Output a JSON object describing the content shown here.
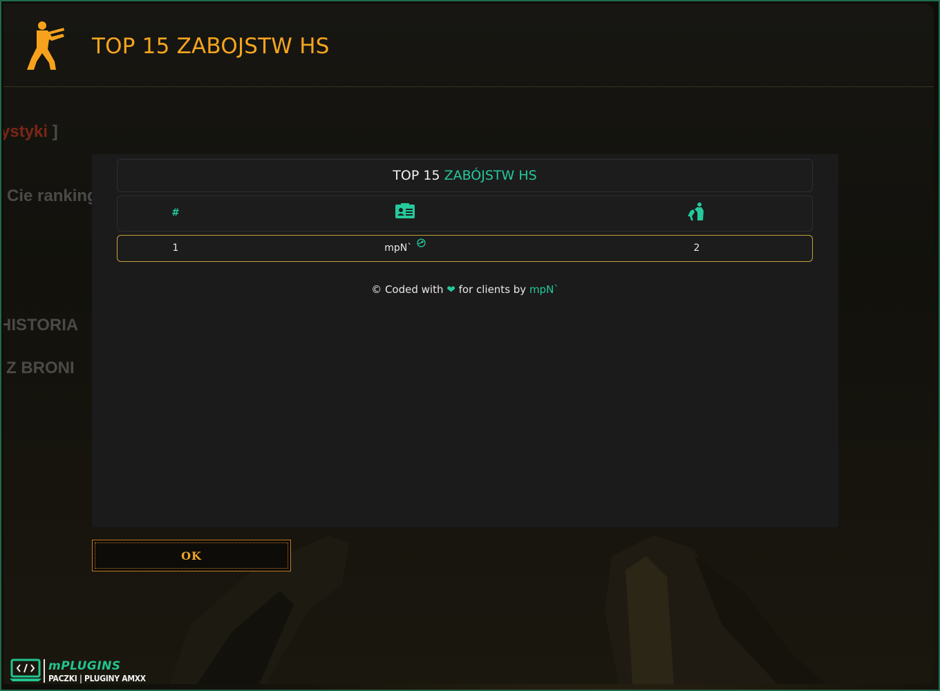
{
  "window": {
    "title": "TOP 15 ZABOJSTW HS"
  },
  "background": {
    "stats_text": "ystyki",
    "stats_bracket": " ]",
    "ranking_text": "Cie ranking",
    "history_text": "HISTORIA",
    "weapons_text": "Z BRONI"
  },
  "modal": {
    "title_prefix": "TOP 15 ",
    "title_accent": "ZABÓJSTW HS",
    "columns": {
      "rank": "#",
      "player_icon": "id-card-icon",
      "kills_icon": "headshot-icon"
    },
    "rows": [
      {
        "rank": "1",
        "name": "mpN`",
        "kills": "2"
      }
    ],
    "footer": {
      "prefix": "© Coded with ",
      "heart": "❤",
      "middle": " for clients by ",
      "author": "mpN`"
    }
  },
  "ok_button": {
    "label": "OK"
  },
  "brand": {
    "name": "mPLUGINS",
    "tagline": "PACZKI | PLUGINY AMXX"
  },
  "colors": {
    "accent": "#25c99b",
    "title_orange": "#f6a51f",
    "row_border": "#c8a23a"
  }
}
